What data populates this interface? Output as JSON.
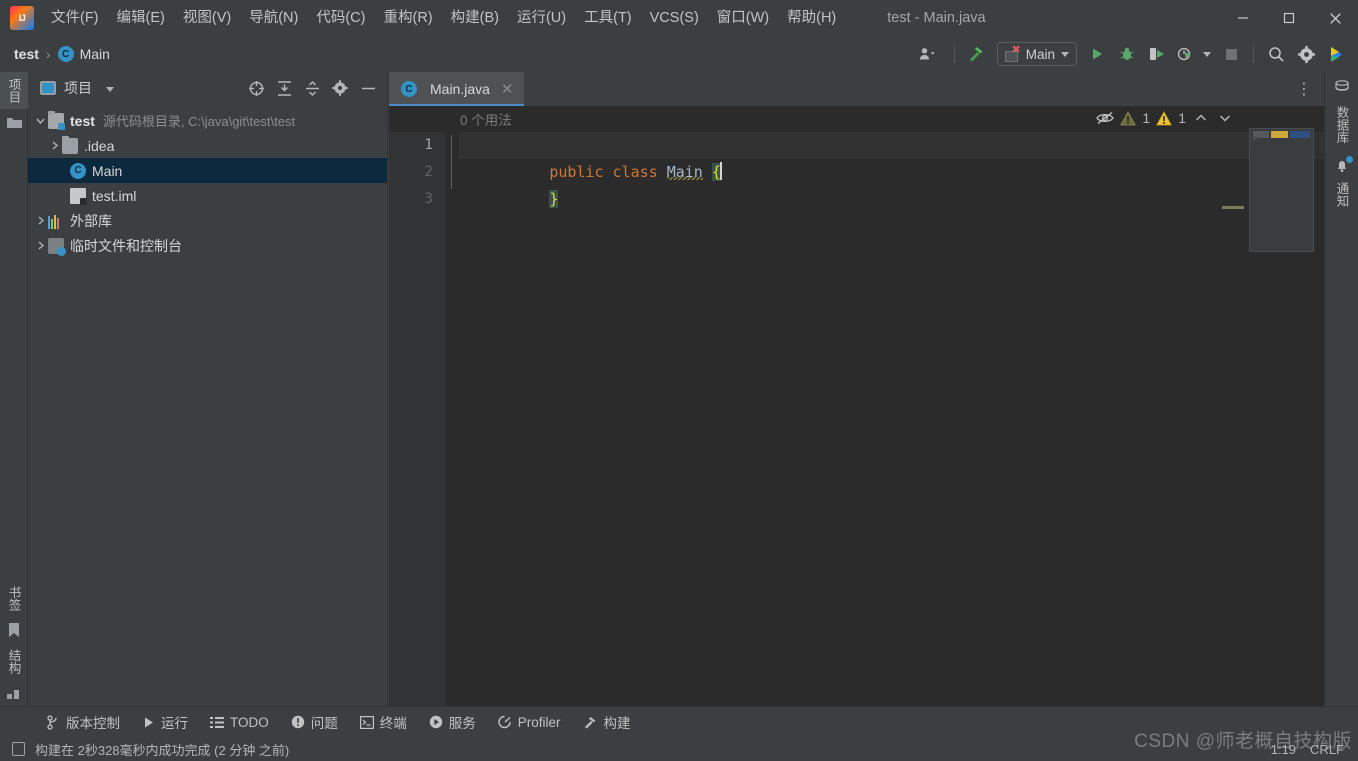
{
  "window": {
    "title": "test - Main.java",
    "minimize_label": "—",
    "maximize_label": "☐",
    "close_label": "✕"
  },
  "menu": [
    {
      "label": "文件(F)",
      "name": "menu-file"
    },
    {
      "label": "编辑(E)",
      "name": "menu-edit"
    },
    {
      "label": "视图(V)",
      "name": "menu-view"
    },
    {
      "label": "导航(N)",
      "name": "menu-navigate"
    },
    {
      "label": "代码(C)",
      "name": "menu-code"
    },
    {
      "label": "重构(R)",
      "name": "menu-refactor"
    },
    {
      "label": "构建(B)",
      "name": "menu-build"
    },
    {
      "label": "运行(U)",
      "name": "menu-run"
    },
    {
      "label": "工具(T)",
      "name": "menu-tools"
    },
    {
      "label": "VCS(S)",
      "name": "menu-vcs"
    },
    {
      "label": "窗口(W)",
      "name": "menu-window"
    },
    {
      "label": "帮助(H)",
      "name": "menu-help"
    }
  ],
  "navbar": {
    "breadcrumb_project": "test",
    "breadcrumb_sep": "›",
    "breadcrumb_class": "Main",
    "class_icon_letter": "C",
    "run_config_name": "Main"
  },
  "project_panel": {
    "title": "项目",
    "tree": [
      {
        "label": "test",
        "meta": "源代码根目录, C:\\java\\git\\test\\test",
        "icon": "source-root-folder-icon",
        "depth": 0,
        "expanded": true,
        "selected": false
      },
      {
        "label": ".idea",
        "meta": "",
        "icon": "folder-icon",
        "depth": 1,
        "expanded": false,
        "selected": false
      },
      {
        "label": "Main",
        "meta": "",
        "icon": "java-class-icon",
        "depth": 2,
        "expanded": null,
        "selected": true
      },
      {
        "label": "test.iml",
        "meta": "",
        "icon": "iml-file-icon",
        "depth": 2,
        "expanded": null,
        "selected": false
      },
      {
        "label": "外部库",
        "meta": "",
        "icon": "external-libraries-icon",
        "depth": 0,
        "expanded": false,
        "selected": false
      },
      {
        "label": "临时文件和控制台",
        "meta": "",
        "icon": "scratches-consoles-icon",
        "depth": 0,
        "expanded": false,
        "selected": false
      }
    ]
  },
  "left_strip": {
    "top_tab": "项目",
    "bottom_tabs": [
      "书签",
      "结构"
    ]
  },
  "right_strip": {
    "tabs": [
      "数据库",
      "通知"
    ]
  },
  "editor": {
    "tab_label": "Main.java",
    "tab_icon_letter": "C",
    "tab_close": "✕",
    "usages_hint": "0 个用法",
    "inspection_warnings_grey": "1",
    "inspection_warnings_yellow": "1",
    "line_numbers": [
      "1",
      "2",
      "3"
    ],
    "code_lines": [
      {
        "tokens": [
          {
            "text": "public",
            "type": "keyword"
          },
          {
            "text": " ",
            "type": "plain"
          },
          {
            "text": "class",
            "type": "keyword"
          },
          {
            "text": " ",
            "type": "plain"
          },
          {
            "text": "Main",
            "type": "classname"
          },
          {
            "text": " ",
            "type": "plain"
          },
          {
            "text": "{",
            "type": "brace"
          }
        ]
      },
      {
        "tokens": [
          {
            "text": "}",
            "type": "brace"
          }
        ]
      },
      {
        "tokens": []
      }
    ]
  },
  "bottom_toolbar": [
    {
      "label": "版本控制",
      "icon": "version-control-icon",
      "name": "bottom-tab-version-control"
    },
    {
      "label": "运行",
      "icon": "run-icon",
      "name": "bottom-tab-run"
    },
    {
      "label": "TODO",
      "icon": "todo-icon",
      "name": "bottom-tab-todo"
    },
    {
      "label": "问题",
      "icon": "problems-icon",
      "name": "bottom-tab-problems"
    },
    {
      "label": "终端",
      "icon": "terminal-icon",
      "name": "bottom-tab-terminal"
    },
    {
      "label": "服务",
      "icon": "services-icon",
      "name": "bottom-tab-services"
    },
    {
      "label": "Profiler",
      "icon": "profiler-icon",
      "name": "bottom-tab-profiler"
    },
    {
      "label": "构建",
      "icon": "build-icon",
      "name": "bottom-tab-build"
    }
  ],
  "status_bar": {
    "message": "构建在 2秒328毫秒内成功完成 (2 分钟 之前)",
    "caret_position": "1:19",
    "line_separator": "CRLF",
    "watermark": "CSDN @师老概自技构版"
  },
  "colors": {
    "accent_blue": "#3592c4",
    "tab_underline": "#4a88c7",
    "selection_blue": "#0d293e",
    "keyword_orange": "#cc7832",
    "brace_yellow": "#e0e02a",
    "editor_bg": "#2b2b2b",
    "chrome_bg": "#3c3f41"
  }
}
